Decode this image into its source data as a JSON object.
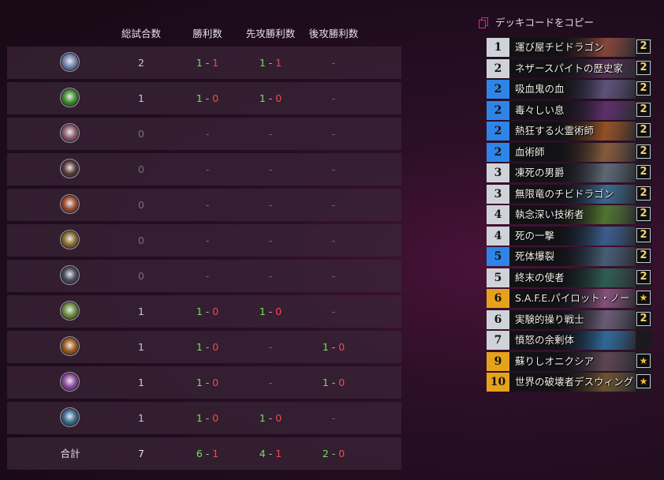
{
  "table": {
    "headers": [
      "総試合数",
      "勝利数",
      "先攻勝利数",
      "後攻勝利数"
    ],
    "rows": [
      {
        "icon": "shield-class-icon",
        "icon_color": "#6f7ea6",
        "games": "2",
        "wins": {
          "w": "1",
          "l": "1"
        },
        "first": {
          "w": "1",
          "l": "1"
        },
        "second": "-"
      },
      {
        "icon": "green-fel-class-icon",
        "icon_color": "#3f8a2a",
        "games": "1",
        "wins": {
          "w": "1",
          "l": "0"
        },
        "first": {
          "w": "1",
          "l": "0"
        },
        "second": "-"
      },
      {
        "icon": "paw-class-icon",
        "icon_color": "#8a5a6a",
        "games": "0",
        "wins": "-",
        "first": "-",
        "second": "-"
      },
      {
        "icon": "dagger-class-icon",
        "icon_color": "#5a3a3a",
        "games": "0",
        "wins": "-",
        "first": "-",
        "second": "-"
      },
      {
        "icon": "fire-class-icon",
        "icon_color": "#9a4a2a",
        "games": "0",
        "wins": "-",
        "first": "-",
        "second": "-"
      },
      {
        "icon": "hammer-class-icon",
        "icon_color": "#8a6a2a",
        "games": "0",
        "wins": "-",
        "first": "-",
        "second": "-"
      },
      {
        "icon": "shadow-class-icon",
        "icon_color": "#4a4a5a",
        "games": "0",
        "wins": "-",
        "first": "-",
        "second": "-"
      },
      {
        "icon": "nature-class-icon",
        "icon_color": "#6a8a3a",
        "games": "1",
        "wins": {
          "w": "1",
          "l": "0"
        },
        "first": {
          "w": "1",
          "l": "0"
        },
        "second": "-"
      },
      {
        "icon": "warrior-class-icon",
        "icon_color": "#9a5a1a",
        "games": "1",
        "wins": {
          "w": "1",
          "l": "0"
        },
        "first": "-",
        "second": {
          "w": "1",
          "l": "0"
        }
      },
      {
        "icon": "arcane-class-icon",
        "icon_color": "#8a4a9a",
        "games": "1",
        "wins": {
          "w": "1",
          "l": "0"
        },
        "first": "-",
        "second": {
          "w": "1",
          "l": "0"
        }
      },
      {
        "icon": "sword-class-icon",
        "icon_color": "#3a6a8a",
        "games": "1",
        "wins": {
          "w": "1",
          "l": "0"
        },
        "first": {
          "w": "1",
          "l": "0"
        },
        "second": "-"
      }
    ],
    "total": {
      "label": "合計",
      "games": "7",
      "wins": {
        "w": "6",
        "l": "1"
      },
      "first": {
        "w": "4",
        "l": "1"
      },
      "second": {
        "w": "2",
        "l": "0"
      }
    }
  },
  "deck": {
    "copy_label": "デッキコードをコピー",
    "cards": [
      {
        "cost": "1",
        "name": "運び屋チビドラゴン",
        "count": "2",
        "rarity": "common",
        "art_color": "#b05a4a"
      },
      {
        "cost": "2",
        "name": "ネザースパイトの歴史家",
        "count": "2",
        "rarity": "common",
        "art_color": "#6a3a6a"
      },
      {
        "cost": "2",
        "name": "吸血鬼の血",
        "count": "2",
        "rarity": "rare",
        "art_color": "#7a6aa0"
      },
      {
        "cost": "2",
        "name": "毒々しい息",
        "count": "2",
        "rarity": "rare",
        "art_color": "#7a3a8a"
      },
      {
        "cost": "2",
        "name": "熱狂する火霊術師",
        "count": "2",
        "rarity": "rare",
        "art_color": "#c46a2a"
      },
      {
        "cost": "2",
        "name": "血術師",
        "count": "2",
        "rarity": "rare",
        "art_color": "#b0784a"
      },
      {
        "cost": "3",
        "name": "凍死の男爵",
        "count": "2",
        "rarity": "common",
        "art_color": "#7a8a9a"
      },
      {
        "cost": "3",
        "name": "無限竜のチビドラゴン",
        "count": "2",
        "rarity": "common",
        "art_color": "#4a8aba"
      },
      {
        "cost": "4",
        "name": "執念深い技術者",
        "count": "2",
        "rarity": "common",
        "art_color": "#6a9a3a"
      },
      {
        "cost": "4",
        "name": "死の一撃",
        "count": "2",
        "rarity": "common",
        "art_color": "#4a7aba"
      },
      {
        "cost": "5",
        "name": "死体爆裂",
        "count": "2",
        "rarity": "rare",
        "art_color": "#5a7a9a"
      },
      {
        "cost": "5",
        "name": "終末の使者",
        "count": "2",
        "rarity": "common",
        "art_color": "#3a7a6a"
      },
      {
        "cost": "6",
        "name": "S.A.F.E.パイロット・ノー",
        "count": "★",
        "rarity": "legendary",
        "art_color": "#b06aa0"
      },
      {
        "cost": "6",
        "name": "実験的操り戦士",
        "count": "2",
        "rarity": "common",
        "art_color": "#8a7a9a"
      },
      {
        "cost": "7",
        "name": "憤怒の余剰体",
        "count": "",
        "rarity": "common",
        "art_color": "#3a8aca"
      },
      {
        "cost": "9",
        "name": "蘇りしオニクシア",
        "count": "★",
        "rarity": "legendary",
        "art_color": "#7a5a6a"
      },
      {
        "cost": "10",
        "name": "世界の破壊者デスウィング",
        "count": "★",
        "rarity": "legendary",
        "art_color": "#8a6a3a"
      }
    ]
  }
}
